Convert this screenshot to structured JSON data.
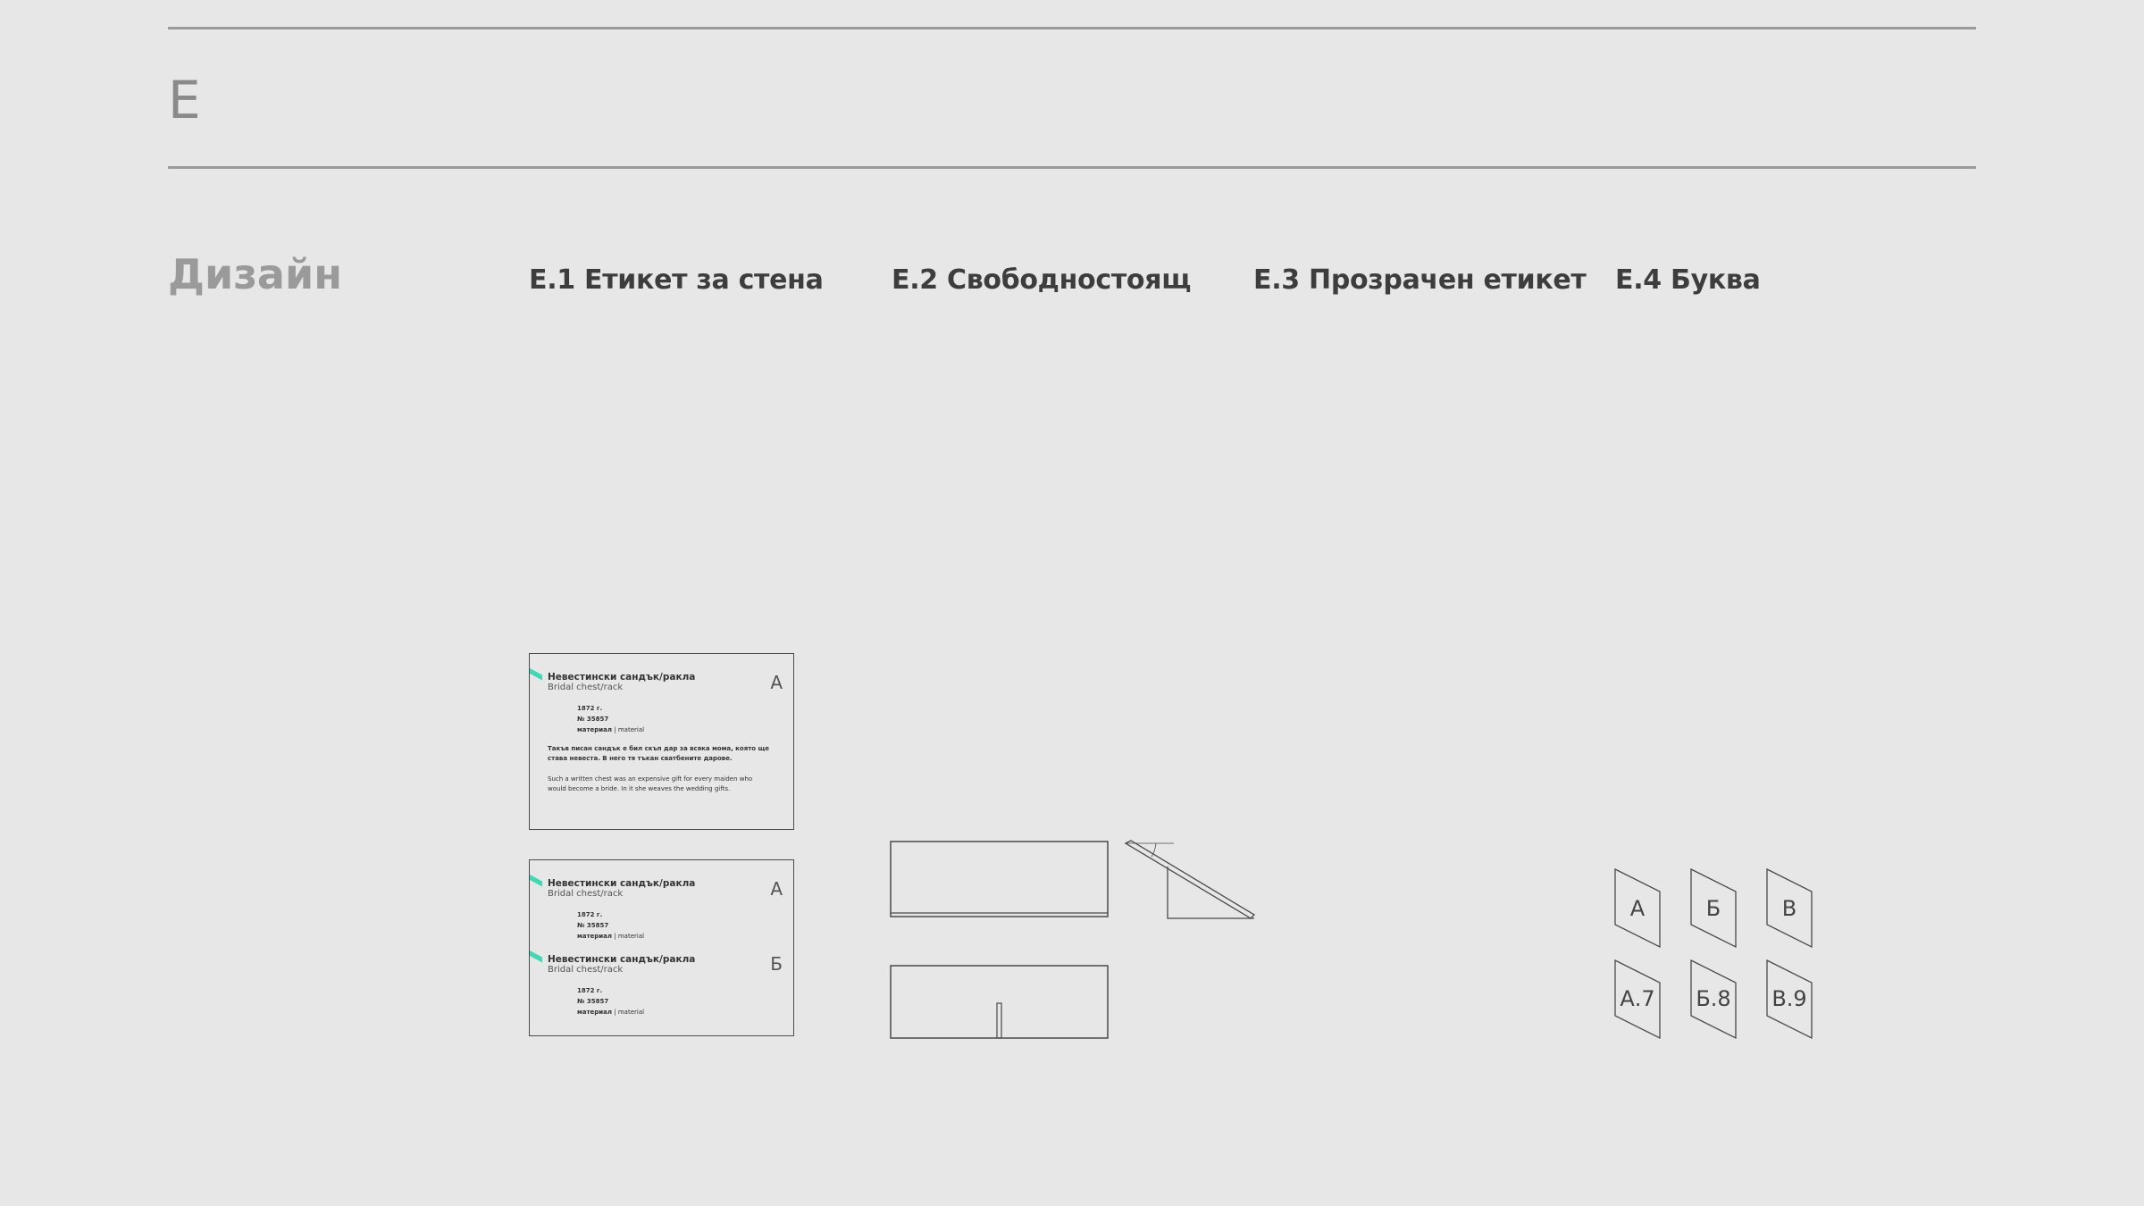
{
  "header": {
    "section_letter": "Е"
  },
  "design": {
    "title": "Дизайн",
    "columns": [
      {
        "label": "Е.1 Етикет за стена"
      },
      {
        "label": "Е.2 Свободностоящ"
      },
      {
        "label": "Е.3 Прозрачен етикет"
      },
      {
        "label": "Е.4 Буква"
      }
    ]
  },
  "wall_label": {
    "accent_color": "#3fd9b4",
    "title_bg": "Невестински сандък/ракла",
    "title_en": "Bridal chest/rack",
    "year": "1872 г.",
    "number": "№ 35857",
    "material_bg": "материал",
    "material_sep": " | ",
    "material_en": "material",
    "letter_a": "А",
    "letter_b": "Б",
    "text_bg": "Такъв писан сандък е бил скъп дар за всяка мома, която ще става невеста. В него тя тъкан сватбените дарове.",
    "text_en": "Such a written chest was an expensive gift for every maiden who would become a bride. In it she weaves the wedding gifts."
  },
  "letter_badges": [
    "А",
    "Б",
    "В",
    "А.7",
    "Б.8",
    "В.9"
  ]
}
